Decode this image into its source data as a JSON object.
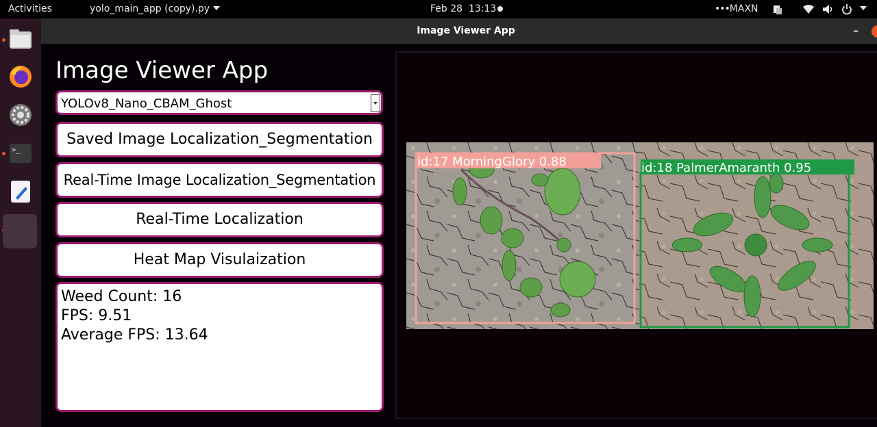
{
  "topbar": {
    "activities": "Activities",
    "app_name": "yolo_main_app (copy).py",
    "date": "Feb 28",
    "time": "13:13",
    "power_mode": "MAXN"
  },
  "dock": {
    "items": [
      "files-icon",
      "firefox-icon",
      "settings-icon",
      "terminal-icon",
      "text-editor-icon",
      "running-app-icon"
    ]
  },
  "window": {
    "title": "Image Viewer App"
  },
  "app": {
    "heading": "Image Viewer App",
    "model_select": {
      "value": "YOLOv8_Nano_CBAM_Ghost"
    },
    "buttons": {
      "saved": "Saved Image Localization_Segmentation",
      "realtime_seg": "Real-Time Image Localization_Segmentation",
      "realtime_loc": "Real-Time Localization",
      "heatmap": "Heat Map Visulaization"
    },
    "stats": {
      "weed_count": "Weed Count: 16",
      "fps": "FPS: 9.51",
      "avg_fps": "Average FPS: 13.64"
    }
  },
  "detections": [
    {
      "label": "id:17 MorningGlory 0.88",
      "color": "#f4a09a"
    },
    {
      "label": "id:18 PalmerAmaranth 0.95",
      "color": "#1e9a46"
    }
  ],
  "colors": {
    "accent": "#9b1b6e",
    "ubuntu_orange": "#e95420"
  }
}
